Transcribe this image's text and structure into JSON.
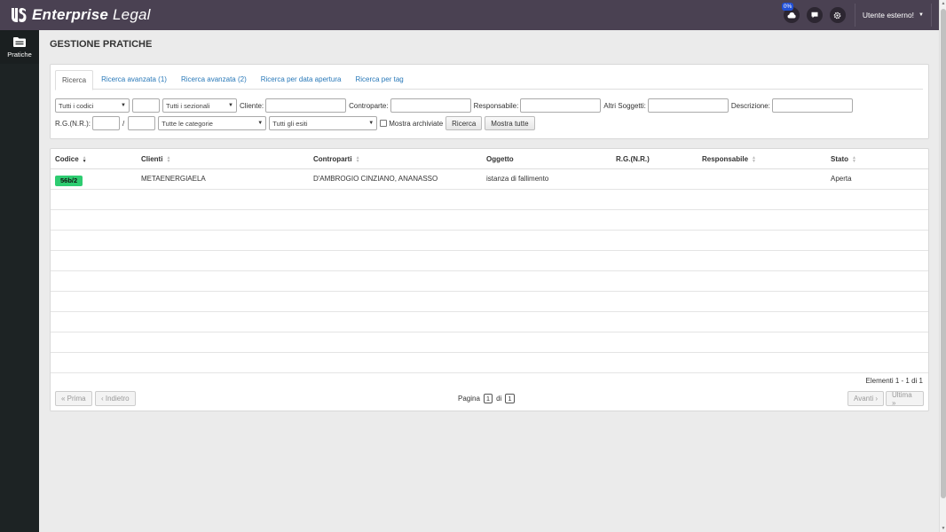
{
  "app": {
    "logo_bold": "Enterprise",
    "logo_light": " Legal"
  },
  "header": {
    "sync_badge": "0%",
    "user_label": "Utente esterno!"
  },
  "sidebar": {
    "items": [
      {
        "label": "Pratiche",
        "icon": "folder-icon"
      }
    ]
  },
  "page": {
    "title": "GESTIONE PRATICHE"
  },
  "search": {
    "tabs": [
      "Ricerca",
      "Ricerca avanzata (1)",
      "Ricerca avanzata (2)",
      "Ricerca per data apertura",
      "Ricerca per tag"
    ],
    "active_tab": 0,
    "codes_select": "Tutti i codici",
    "sections_select": "Tutti i sezionali",
    "client_label": "Cliente:",
    "counterpart_label": "Controparte:",
    "responsible_label": "Responsabile:",
    "other_subjects_label": "Altri Soggetti:",
    "description_label": "Descrizione:",
    "rg_label": "R.G.(N.R.):",
    "rg_sep": "/",
    "categories_select": "Tutte le categorie",
    "outcomes_select": "Tutti gli esiti",
    "show_archived_label": "Mostra archiviate",
    "search_button": "Ricerca",
    "show_all_button": "Mostra tutte"
  },
  "table": {
    "columns": [
      "Codice",
      "Clienti",
      "Controparti",
      "Oggetto",
      "R.G.(N.R.)",
      "Responsabile",
      "Stato"
    ],
    "rows": [
      {
        "code": "56b/2",
        "clients": "METAENERGIAELA",
        "counterparts": "D'AMBROGIO CINZIANO, ANANASSO",
        "object": "istanza di fallimento",
        "rg": "",
        "responsible": "",
        "status": "Aperta"
      }
    ],
    "badge_color": "#2ecc71"
  },
  "pagination": {
    "summary": "Elementi 1 - 1 di 1",
    "first": "« Prima",
    "prev": "‹ Indietro",
    "page_label": "Pagina",
    "current_page": "1",
    "of_label": "di",
    "total_pages": "1",
    "next": "Avanti ›",
    "last": "Ultima »"
  },
  "colors": {
    "topbar": "#4a4152",
    "sidebar": "#1d2324",
    "link": "#2878b8"
  }
}
